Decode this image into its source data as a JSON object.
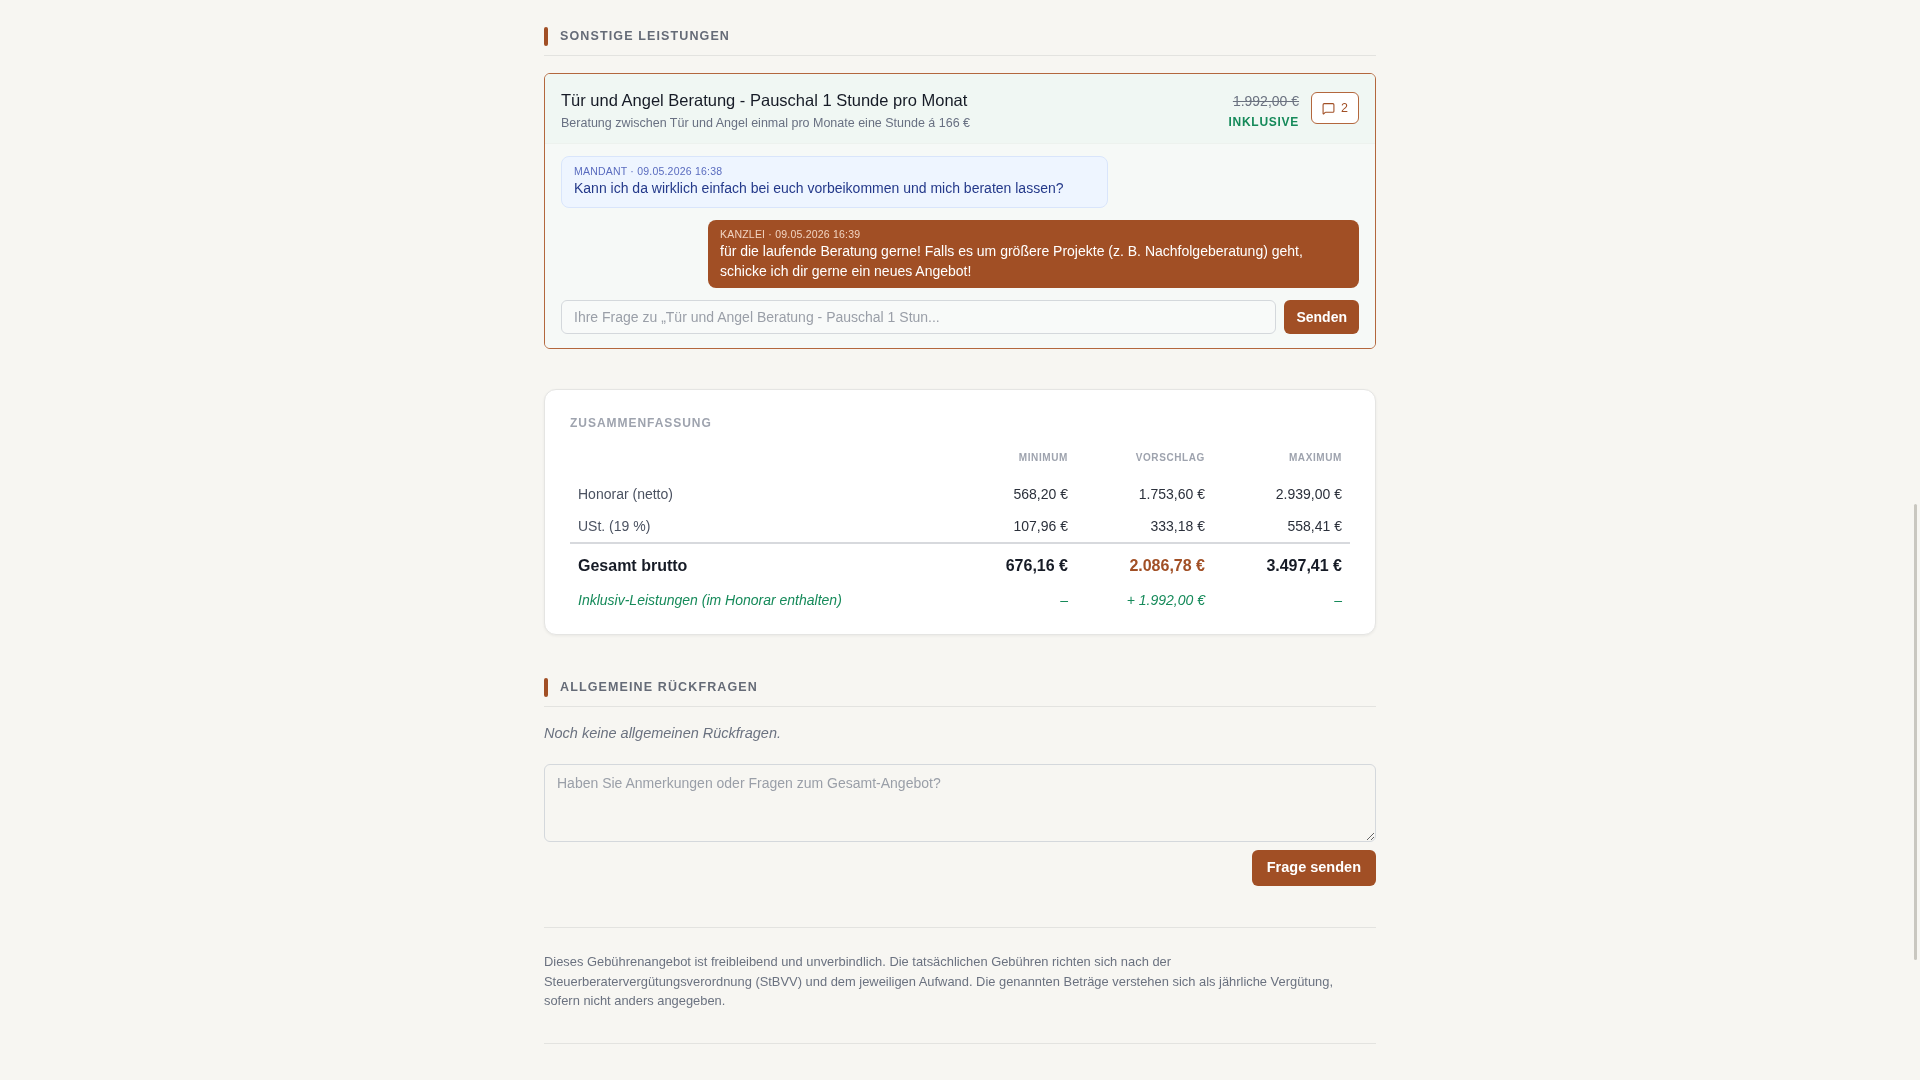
{
  "other_services": {
    "heading": "SONSTIGE LEISTUNGEN",
    "items": [
      {
        "title": "Tür und Angel Beratung - Pauschal 1 Stunde pro Monat",
        "description": "Beratung zwischen Tür und Angel einmal pro Monate eine Stunde á 166 €",
        "price": "1.992,00 €",
        "included": true,
        "badge": "INKLUSIVE",
        "comment_count": "2",
        "expanded": true,
        "messages": [
          {
            "kind": "client",
            "meta": "MANDANT · 09.05.2026 16:38",
            "text": "Kann ich da wirklich einfach bei euch vorbeikommen und mich beraten lassen?"
          },
          {
            "kind": "firm",
            "meta": "KANZLEI · 09.05.2026 16:39",
            "text": "für die laufende Beratung gerne! Falls es um größere Projekte (z. B. Nachfolgeberatung) geht, schicke ich dir gerne ein neues Angebot!"
          }
        ],
        "question_input": {
          "placeholder": "Ihre Frage zu „Tür und Angel Beratung - Pauschal 1 Stun..."
        },
        "send_button": "Senden"
      }
    ]
  },
  "summary": {
    "heading": "ZUSAMMENFASSUNG",
    "columns": [
      "MINIMUM",
      "VORSCHLAG",
      "MAXIMUM"
    ],
    "rows": [
      {
        "kind": "line",
        "label": "Honorar (netto)",
        "values": [
          "568,20 €",
          "1.753,60 €",
          "2.939,00 €"
        ]
      },
      {
        "kind": "line",
        "label": "USt. (19 %)",
        "values": [
          "107,96 €",
          "333,18 €",
          "558,41 €"
        ]
      },
      {
        "kind": "total",
        "label": "Gesamt brutto",
        "values": [
          {
            "text": "676,16 €",
            "highlighted": false
          },
          {
            "text": "2.086,78 €",
            "highlighted": true
          },
          {
            "text": "3.497,41 €",
            "highlighted": false
          }
        ]
      },
      {
        "kind": "inclusive",
        "label": "Inklusiv-Leistungen (im Honorar enthalten)",
        "values": [
          "–",
          "+ 1.992,00 €",
          "–"
        ]
      }
    ]
  },
  "general_questions": {
    "heading": "ALLGEMEINE RÜCKFRAGEN",
    "empty_note": "Noch keine allgemeinen Rückfragen.",
    "textarea": {
      "placeholder": "Haben Sie Anmerkungen oder Fragen zum Gesamt-Angebot?"
    },
    "submit_button": "Frage senden"
  },
  "footer_note": "Dieses Gebührenangebot ist freibleibend und unverbindlich. Die tatsächlichen Gebühren richten sich nach der Steuerberatervergütungsverordnung (StBVV) und dem jeweiligen Aufwand. Die genannten Beträge verstehen sich als jährliche Vergütung, sofern nicht anders angegeben."
}
